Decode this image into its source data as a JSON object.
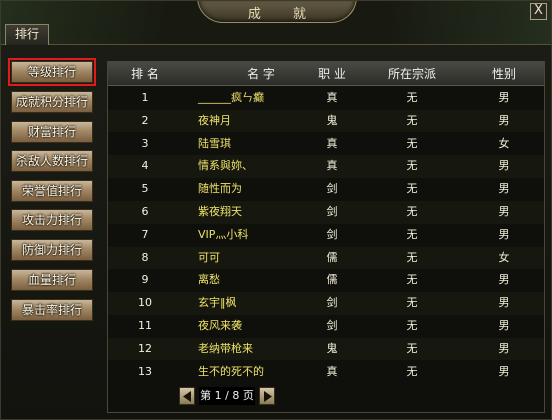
{
  "window": {
    "title": "成 就",
    "close_label": "X"
  },
  "tabs": [
    {
      "label": "排行"
    }
  ],
  "sidebar": {
    "items": [
      {
        "label": "等级排行",
        "active": true
      },
      {
        "label": "成就积分排行"
      },
      {
        "label": "财富排行"
      },
      {
        "label": "杀敌人数排行"
      },
      {
        "label": "荣誉值排行"
      },
      {
        "label": "攻击力排行"
      },
      {
        "label": "防御力排行"
      },
      {
        "label": "血量排行"
      },
      {
        "label": "暴击率排行"
      }
    ]
  },
  "table": {
    "headers": {
      "rank": "排 名",
      "name": "名 字",
      "job": "职 业",
      "sect": "所在宗派",
      "gender": "性别"
    },
    "rows": [
      {
        "rank": "1",
        "name": "______疯ㄣ癫",
        "job": "真",
        "sect": "无",
        "gender": "男"
      },
      {
        "rank": "2",
        "name": "夜神月",
        "job": "鬼",
        "sect": "无",
        "gender": "男"
      },
      {
        "rank": "3",
        "name": "陆雪琪",
        "job": "真",
        "sect": "无",
        "gender": "女"
      },
      {
        "rank": "4",
        "name": "情系與妳、",
        "job": "真",
        "sect": "无",
        "gender": "男"
      },
      {
        "rank": "5",
        "name": "随性而为",
        "job": "剑",
        "sect": "无",
        "gender": "男"
      },
      {
        "rank": "6",
        "name": "紫夜翔天",
        "job": "剑",
        "sect": "无",
        "gender": "男"
      },
      {
        "rank": "7",
        "name": "VIP灬小科",
        "job": "剑",
        "sect": "无",
        "gender": "男"
      },
      {
        "rank": "8",
        "name": "可可",
        "job": "儒",
        "sect": "无",
        "gender": "女"
      },
      {
        "rank": "9",
        "name": "离愁",
        "job": "儒",
        "sect": "无",
        "gender": "男"
      },
      {
        "rank": "10",
        "name": "玄宇‖枫",
        "job": "剑",
        "sect": "无",
        "gender": "男"
      },
      {
        "rank": "11",
        "name": "夜风来袭",
        "job": "剑",
        "sect": "无",
        "gender": "男"
      },
      {
        "rank": "12",
        "name": "老纳带枪来",
        "job": "鬼",
        "sect": "无",
        "gender": "男"
      },
      {
        "rank": "13",
        "name": "生不的死不的",
        "job": "真",
        "sect": "无",
        "gender": "男"
      }
    ]
  },
  "pager": {
    "text": "第 1 / 8 页",
    "prev_icon": "triangle-left-icon",
    "next_icon": "triangle-right-icon"
  },
  "colors": {
    "name_text": "#efe36a",
    "active_outline": "#e01b1b",
    "button_gold": "#a38866"
  }
}
